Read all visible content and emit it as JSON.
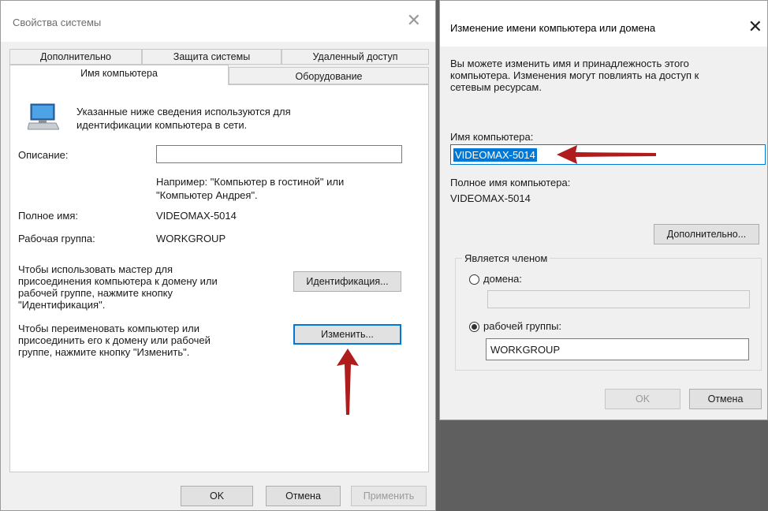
{
  "system_properties": {
    "title": "Свойства системы",
    "tabs_row1": [
      "Дополнительно",
      "Защита системы",
      "Удаленный доступ"
    ],
    "tabs_row2": [
      "Имя компьютера",
      "Оборудование"
    ],
    "info_text": "Указанные ниже сведения используются для\nидентификации компьютера в сети.",
    "description_label": "Описание:",
    "description_value": "",
    "example_text": "Например: \"Компьютер в гостиной\" или\n\"Компьютер Андрея\".",
    "full_name_label": "Полное имя:",
    "full_name_value": "VIDEOMAX-5014",
    "workgroup_label": "Рабочая группа:",
    "workgroup_value": "WORKGROUP",
    "wizard_text": "Чтобы использовать мастер для\nприсоединения компьютера к домену или\nрабочей группе, нажмите кнопку\n\"Идентификация\".",
    "identify_button": "Идентификация...",
    "rename_text": "Чтобы переименовать компьютер или\nприсоединить его к домену или рабочей\nгруппе, нажмите кнопку \"Изменить\".",
    "change_button": "Изменить...",
    "ok_button": "OK",
    "cancel_button": "Отмена",
    "apply_button": "Применить"
  },
  "rename_dialog": {
    "title": "Изменение имени компьютера или домена",
    "intro_text": "Вы можете изменить имя и принадлежность этого\nкомпьютера. Изменения могут повлиять на доступ к\nсетевым ресурсам.",
    "computer_name_label": "Имя компьютера:",
    "computer_name_value": "VIDEOMAX-5014",
    "full_name_label": "Полное имя компьютера:",
    "full_name_value": "VIDEOMAX-5014",
    "more_button": "Дополнительно...",
    "member_of_label": "Является членом",
    "domain_option": "домена:",
    "domain_value": "",
    "workgroup_option": "рабочей группы:",
    "workgroup_value": "WORKGROUP",
    "selected_option": "workgroup",
    "ok_button": "OK",
    "cancel_button": "Отмена"
  },
  "colors": {
    "annotation_arrow": "#b01c1c",
    "selection": "#0078d7",
    "focus_border": "#0078d7"
  }
}
